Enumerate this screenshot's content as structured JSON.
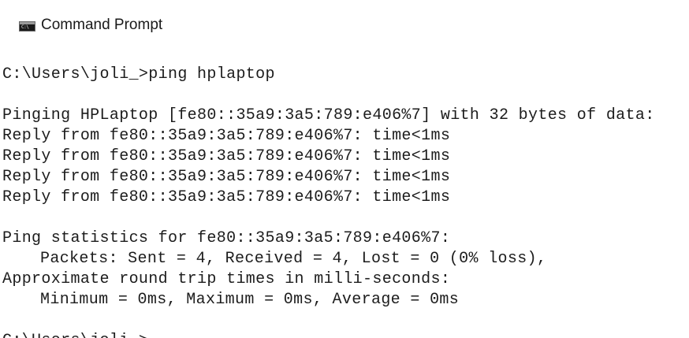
{
  "window": {
    "title": "Command Prompt",
    "icon": "cmd-icon",
    "icon_glyph": "C:\\"
  },
  "console": {
    "command_line": "C:\\Users\\joli_>ping hplaptop",
    "pinging": "Pinging HPLaptop [fe80::35a9:3a5:789:e406%7] with 32 bytes of data:",
    "replies": [
      "Reply from fe80::35a9:3a5:789:e406%7: time<1ms",
      "Reply from fe80::35a9:3a5:789:e406%7: time<1ms",
      "Reply from fe80::35a9:3a5:789:e406%7: time<1ms",
      "Reply from fe80::35a9:3a5:789:e406%7: time<1ms"
    ],
    "stats_header": "Ping statistics for fe80::35a9:3a5:789:e406%7:",
    "packets": "Packets: Sent = 4, Received = 4, Lost = 0 (0% loss),",
    "rtt_header": "Approximate round trip times in milli-seconds:",
    "rtt_values": "Minimum = 0ms, Maximum = 0ms, Average = 0ms",
    "prompt": "C:\\Users\\joli_>"
  }
}
